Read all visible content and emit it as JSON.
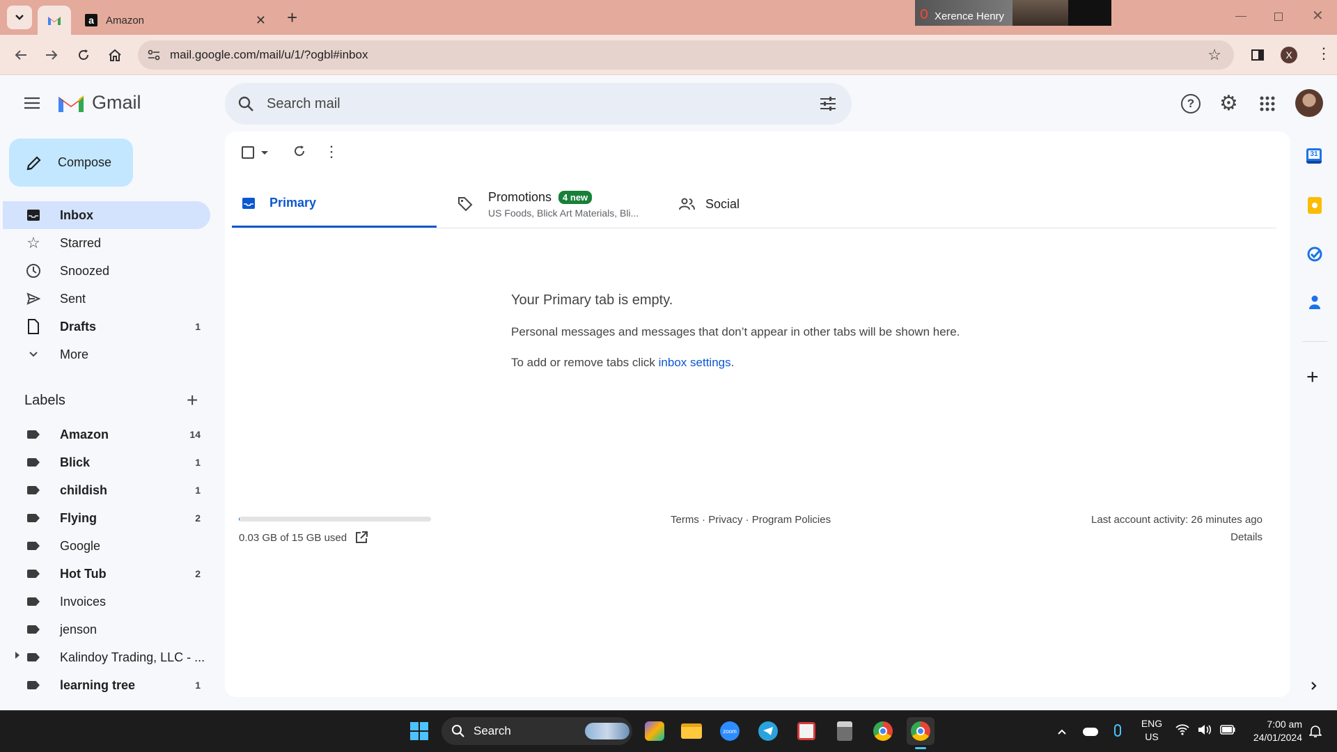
{
  "browser": {
    "tabs": [
      {
        "title": ""
      },
      {
        "title": "Amazon"
      }
    ],
    "new_tab": "+",
    "url": "mail.google.com/mail/u/1/?ogbl#inbox",
    "profile_initial": "X",
    "video_overlay_name": "Xerence Henry"
  },
  "gmail": {
    "logo_text": "Gmail",
    "search_placeholder": "Search mail",
    "compose_label": "Compose",
    "nav": [
      {
        "label": "Inbox",
        "count": "",
        "icon": "inbox-icon"
      },
      {
        "label": "Starred",
        "count": "",
        "icon": "star-icon"
      },
      {
        "label": "Snoozed",
        "count": "",
        "icon": "clock-icon"
      },
      {
        "label": "Sent",
        "count": "",
        "icon": "send-icon"
      },
      {
        "label": "Drafts",
        "count": "1",
        "icon": "draft-icon"
      },
      {
        "label": "More",
        "count": "",
        "icon": "chevron-down-icon"
      }
    ],
    "labels_heading": "Labels",
    "labels": [
      {
        "label": "Amazon",
        "count": "14"
      },
      {
        "label": "Blick",
        "count": "1"
      },
      {
        "label": "childish",
        "count": "1"
      },
      {
        "label": "Flying",
        "count": "2"
      },
      {
        "label": "Google",
        "count": ""
      },
      {
        "label": "Hot Tub",
        "count": "2"
      },
      {
        "label": "Invoices",
        "count": ""
      },
      {
        "label": "jenson",
        "count": ""
      },
      {
        "label": "Kalindoy Trading, LLC - ...",
        "count": ""
      },
      {
        "label": "learning tree",
        "count": "1"
      }
    ],
    "inbox_tabs": {
      "primary": "Primary",
      "promotions": "Promotions",
      "promotions_badge": "4 new",
      "promotions_sub": "US Foods, Blick Art Materials, Bli...",
      "social": "Social"
    },
    "empty": {
      "title": "Your Primary tab is empty.",
      "line1": "Personal messages and messages that don’t appear in other tabs will be shown here.",
      "line2_prefix": "To add or remove tabs click ",
      "line2_link": "inbox settings",
      "line2_suffix": "."
    },
    "footer": {
      "storage": "0.03 GB of 15 GB used",
      "storage_fraction": 0.002,
      "terms": "Terms",
      "sep": " · ",
      "privacy": "Privacy",
      "policies": "Program Policies",
      "activity": "Last account activity: 26 minutes ago",
      "details": "Details"
    },
    "calendar_day": "31"
  },
  "taskbar": {
    "search": "Search",
    "lang1": "ENG",
    "lang2": "US",
    "time": "7:00 am",
    "date": "24/01/2024",
    "zoom_text": "zoom"
  },
  "colors": {
    "accent": "#0b57d0",
    "compose_bg": "#c2e7ff",
    "selected_bg": "#d3e3fd",
    "badge_green": "#188038"
  }
}
